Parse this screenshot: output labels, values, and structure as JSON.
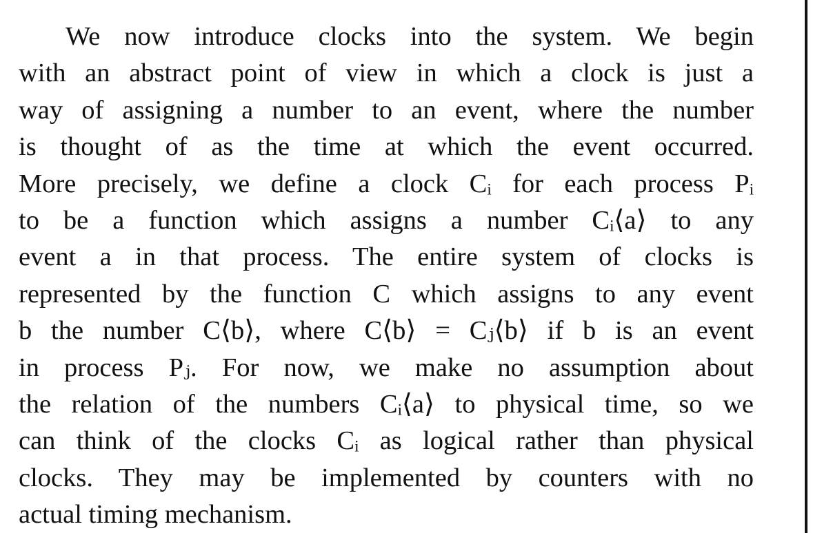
{
  "paragraph": {
    "lines": [
      "We now introduce clocks into the system. We begin",
      "with an abstract point of view in which a clock is just a",
      "way of assigning a number to an event, where the number",
      "is thought of as the time at which the event occurred.",
      "More precisely, we define a clock Cᵢ for each process Pᵢ",
      "to be a function which assigns a number Cᵢ⟨a⟩ to any",
      "event a in that process. The entire system of clocks is",
      "represented by the function C which assigns to any event",
      "b the number C⟨b⟩, where C⟨b⟩ = Cⱼ⟨b⟩ if b is an event",
      "in process Pⱼ. For now, we make no assumption about",
      "the relation of the numbers Cᵢ⟨a⟩ to physical time, so we",
      "can think of the clocks Cᵢ as logical rather than physical",
      "clocks. They may be implemented by counters with no",
      "actual timing mechanism."
    ]
  }
}
